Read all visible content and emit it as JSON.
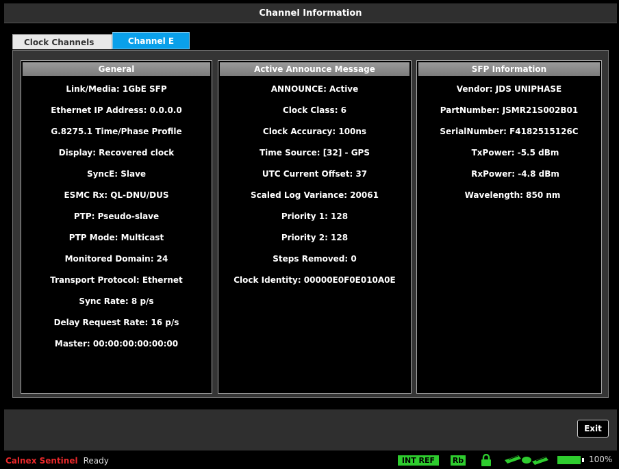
{
  "window": {
    "title": "Channel Information"
  },
  "tabs": [
    {
      "label": "Clock Channels",
      "active": false
    },
    {
      "label": "Channel E",
      "active": true
    }
  ],
  "general": {
    "header": "General",
    "rows": [
      "Link/Media: 1GbE SFP",
      "Ethernet IP Address: 0.0.0.0",
      "G.8275.1 Time/Phase Profile",
      "Display: Recovered clock",
      "SyncE: Slave",
      "ESMC Rx: QL-DNU/DUS",
      "PTP: Pseudo-slave",
      "PTP Mode: Multicast",
      "Monitored Domain: 24",
      "Transport Protocol: Ethernet",
      "Sync Rate: 8 p/s",
      "Delay Request Rate: 16 p/s",
      "Master: 00:00:00:00:00:00"
    ]
  },
  "announce": {
    "header": "Active Announce Message",
    "rows": [
      "ANNOUNCE: Active",
      "Clock Class: 6",
      "Clock Accuracy: 100ns",
      "Time Source: [32] - GPS",
      "UTC Current Offset: 37",
      "Scaled Log Variance: 20061",
      "Priority 1: 128",
      "Priority 2: 128",
      "Steps Removed: 0",
      "Clock Identity: 00000E0F0E010A0E"
    ]
  },
  "sfp": {
    "header": "SFP Information",
    "rows": [
      "Vendor: JDS UNIPHASE",
      "PartNumber: JSMR21S002B01",
      "SerialNumber: F4182515126C",
      "TxPower: -5.5 dBm",
      "RxPower: -4.8 dBm",
      "Wavelength: 850 nm"
    ]
  },
  "footer": {
    "exit_label": "Exit"
  },
  "status": {
    "brand": "Calnex Sentinel",
    "state": "Ready",
    "int_ref": "INT REF",
    "rb": "Rb",
    "battery": "100%",
    "battery_level": 1.0,
    "colors": {
      "brand": "#e8282a",
      "indicator": "#2ecc2e",
      "active_tab": "#0aa0ea"
    },
    "icons": [
      "lock-icon",
      "satellite-icon",
      "battery-icon"
    ]
  }
}
